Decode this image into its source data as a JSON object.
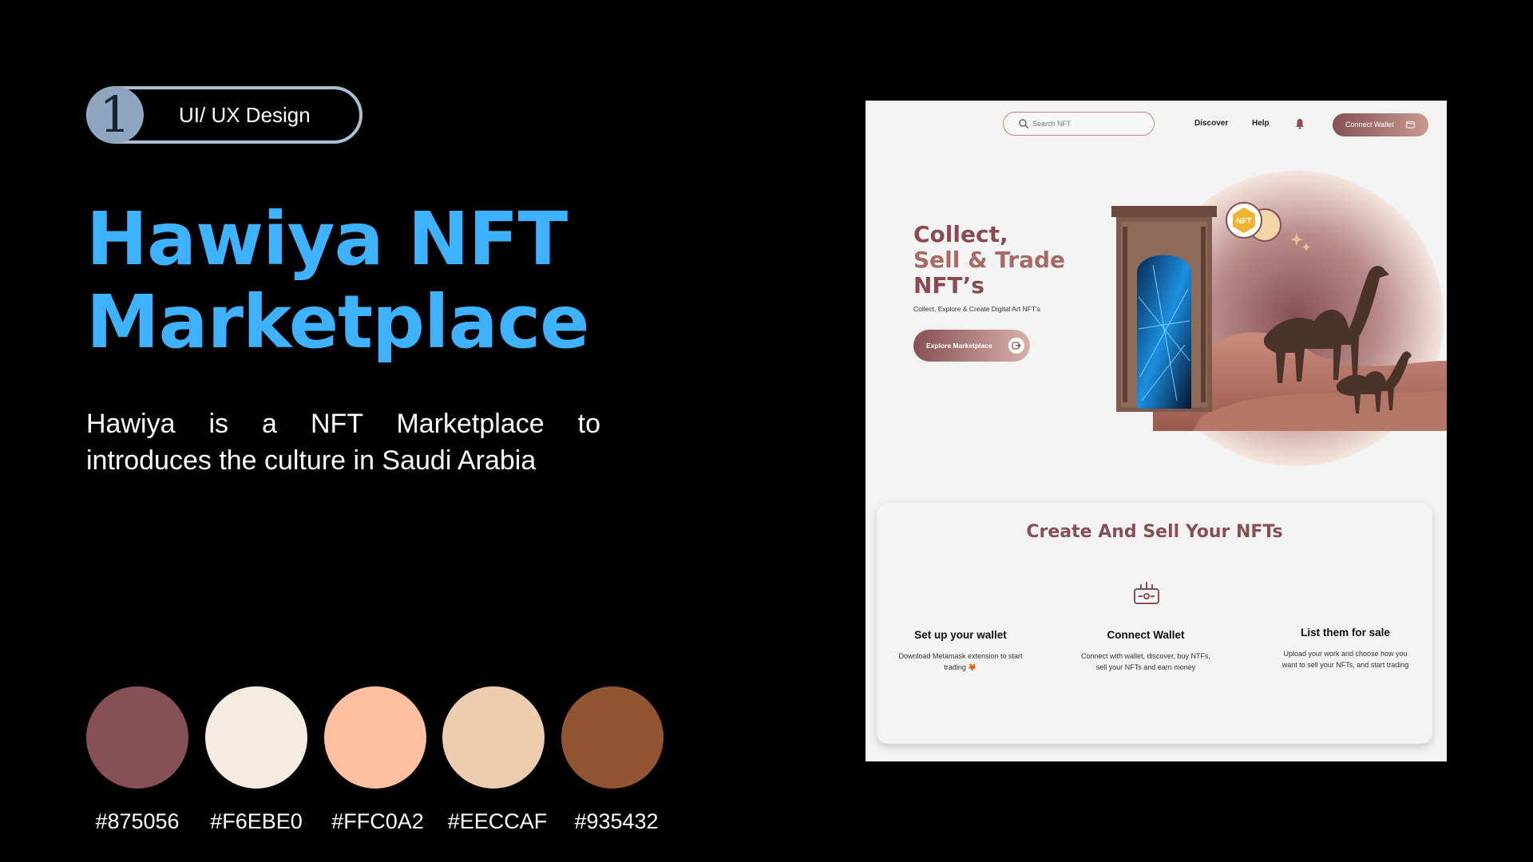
{
  "badge": {
    "number": "1",
    "label": "UI/ UX Design"
  },
  "title": {
    "line1": "Hawiya NFT",
    "line2": "Marketplace"
  },
  "description": "Hawiya is a NFT Marketplace to introduces the culture in Saudi Arabia",
  "palette": [
    {
      "hex": "#875056",
      "label": "#875056"
    },
    {
      "hex": "#F6EBE0",
      "label": "#F6EBE0"
    },
    {
      "hex": "#FFC0A2",
      "label": "#FFC0A2"
    },
    {
      "hex": "#EECCAF",
      "label": "#EECCAF"
    },
    {
      "hex": "#935432",
      "label": "#935432"
    }
  ],
  "colors": {
    "title": "#3FB2FF",
    "accent": "#875056",
    "badge_circle": "#8FA6C1"
  },
  "mockup": {
    "header": {
      "search_placeholder": "Search NFT",
      "nav": [
        "Discover",
        "Help"
      ],
      "connect_label": "Connect Wallet",
      "icons": [
        "search-icon",
        "bell-icon",
        "wallet-icon"
      ]
    },
    "hero": {
      "title_lines": [
        "Collect,",
        "Sell & Trade",
        "NFT’s"
      ],
      "subtitle": "Collect, Explore & Create Digital Art NFT's",
      "button_label": "Explore Marketplace",
      "nft_badge": "NFT"
    },
    "section": {
      "title": "Create And Sell Your NFTs",
      "icon": "wallet-device-icon",
      "steps": [
        {
          "title": "Set up your wallet",
          "desc": "Download Metamask extension to start trading 🦊"
        },
        {
          "title": "Connect Wallet",
          "desc": "Connect with wallet, discover, buy NTFs, sell your NFTs and earn money"
        },
        {
          "title": "List them for sale",
          "desc": "Upload your work and choose how you want to sell your NFTs, and start trading"
        }
      ]
    }
  }
}
